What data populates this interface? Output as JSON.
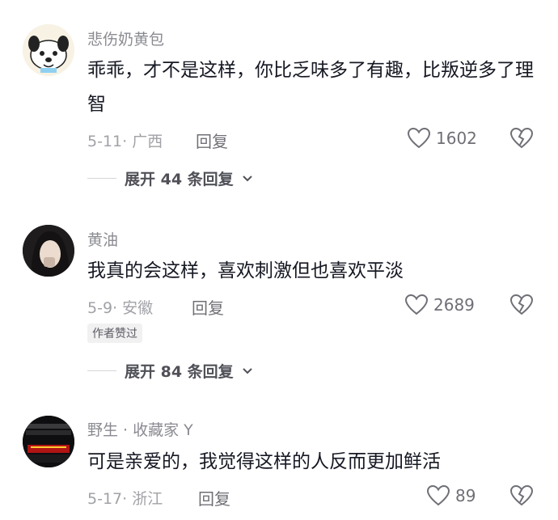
{
  "comments": [
    {
      "username": "悲伤奶黄包",
      "text": "乖乖，才不是这样，你比乏味多了有趣，比叛逆多了理智",
      "date_location": "5-11· 广西",
      "reply_label": "回复",
      "likes": "1602",
      "badge": "",
      "expand_label": "展开 44 条回复"
    },
    {
      "username": "黄油",
      "text": "我真的会这样，喜欢刺激但也喜欢平淡",
      "date_location": "5-9· 安徽",
      "reply_label": "回复",
      "likes": "2689",
      "badge": "作者赞过",
      "expand_label": "展开 84 条回复"
    },
    {
      "username": "野生 · 收藏家 Y",
      "text": "可是亲爱的，我觉得这样的人反而更加鲜活",
      "date_location": "5-17· 浙江",
      "reply_label": "回复",
      "likes": "89",
      "badge": "",
      "expand_label": ""
    }
  ],
  "icons": {
    "like": "heart-outline-icon",
    "dislike": "broken-heart-icon",
    "expand": "chevron-down-icon"
  },
  "colors": {
    "text": "#161823",
    "username": "#8a8b91",
    "meta": "#a1a2a7"
  }
}
